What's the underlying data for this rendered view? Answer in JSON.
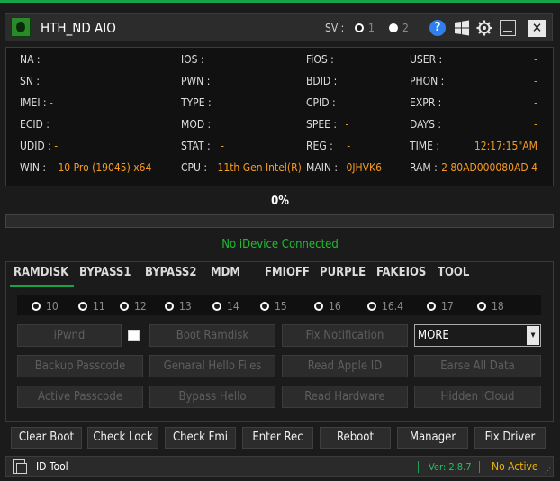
{
  "titlebar": {
    "title": "HTH_ND AIO",
    "sv_label": "SV :",
    "sv_options": [
      "1",
      "2"
    ],
    "help_label": "?",
    "close_label": "✕"
  },
  "info": {
    "na_label": "NA :",
    "na_value": "",
    "sn_label": "SN :",
    "sn_value": "",
    "imei_label": "IMEI :",
    "imei_value": "-",
    "ecid_label": "ECID :",
    "ecid_value": "",
    "udid_label": "UDID :",
    "udid_value": "-",
    "win_label": "WIN :",
    "win_value": "10 Pro (19045)  x64",
    "ios_label": "IOS :",
    "ios_value": "",
    "pwn_label": "PWN :",
    "pwn_value": "",
    "type_label": "TYPE :",
    "type_value": "",
    "mod_label": "MOD :",
    "mod_value": "",
    "stat_label": "STAT :",
    "stat_value": "-",
    "cpu_label": "CPU :",
    "cpu_value": "11th Gen Intel(R)",
    "fios_label": "FiOS :",
    "fios_value": "",
    "bdid_label": "BDID :",
    "bdid_value": "",
    "cpid_label": "CPID :",
    "cpid_value": "",
    "spee_label": "SPEE :",
    "spee_value": "-",
    "reg_label": "REG :",
    "reg_value": "-",
    "main_label": "MAIN :",
    "main_value": "0JHVK6",
    "user_label": "USER :",
    "user_value": "-",
    "phon_label": "PHON :",
    "phon_value": "-",
    "expr_label": "EXPR :",
    "expr_value": "-",
    "days_label": "DAYS :",
    "days_value": "-",
    "time_label": "TIME :",
    "time_value": "12:17:15\"AM",
    "ram_label": "RAM :",
    "ram_value": "2 80AD000080AD 4"
  },
  "progress": {
    "label": "0%",
    "value": 0
  },
  "status": {
    "text": "No iDevice Connected"
  },
  "tabs": [
    "RAMDISK",
    "BYPASS1",
    "BYPASS2",
    "MDM",
    "FMIOFF",
    "PURPLE",
    "FAKEIOS",
    "TOOL"
  ],
  "active_tab": "RAMDISK",
  "ios_versions": [
    "10",
    "11",
    "12",
    "13",
    "14",
    "15",
    "16",
    "16.4",
    "17",
    "18"
  ],
  "ramdisk_buttons": {
    "ipwnd": "iPwnd",
    "boot_ramdisk": "Boot Ramdisk",
    "fix_notification": "Fix Notification",
    "more_select": "MORE",
    "backup_passcode": "Backup Passcode",
    "genaral_hello_files": "Genaral Hello Files",
    "read_apple_id": "Read Apple ID",
    "earse_all_data": "Earse All Data",
    "active_passcode": "Active Passcode",
    "bypass_hello": "Bypass Hello",
    "read_hardware": "Read Hardware",
    "hidden_icloud": "Hidden iCloud"
  },
  "actions": [
    "Clear Boot",
    "Check Lock",
    "Check Fmi",
    "Enter Rec",
    "Reboot",
    "Manager",
    "Fix Driver"
  ],
  "footer": {
    "tool_label": "ID Tool",
    "version": "Ver: 2.8.7",
    "activation": "No Active"
  },
  "colors": {
    "accent_green": "#16a34a",
    "value_orange": "#f59a23",
    "status_green": "#22bb33",
    "warning_yellow": "#eab308",
    "help_blue": "#2f80ed"
  }
}
